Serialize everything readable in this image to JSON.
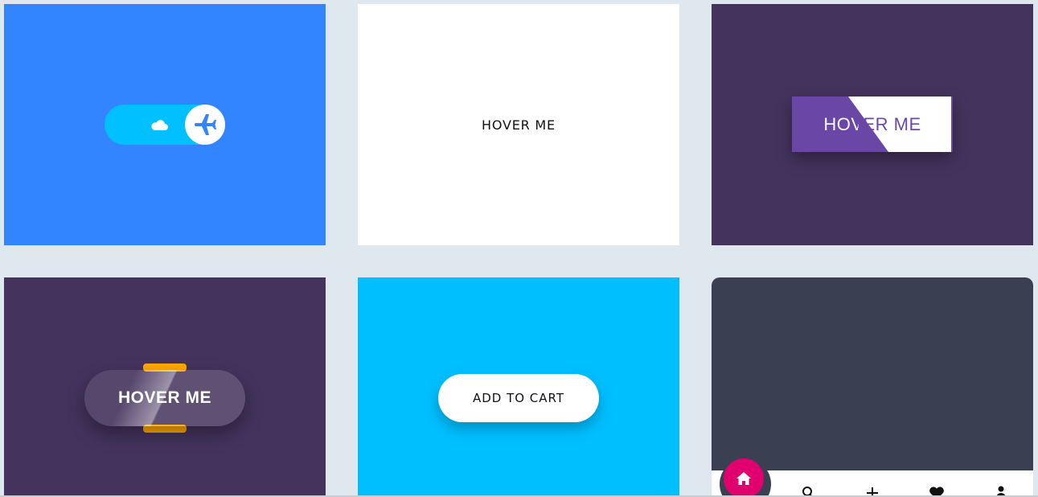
{
  "cards": {
    "toggle": {
      "icons": {
        "cloud": "cloud-icon",
        "knob": "airplane-icon"
      },
      "colors": {
        "background": "#3385ff",
        "track": "#00c0ff",
        "icon": "#3385ff"
      }
    },
    "plain": {
      "label": "HOVER ME"
    },
    "slant": {
      "label": "HOVER ME",
      "colors": {
        "background": "#44335d",
        "accent": "#6a47a6"
      }
    },
    "glass": {
      "label": "HOVER ME",
      "colors": {
        "background": "#44335d",
        "accent": "#ffa800"
      }
    },
    "cart": {
      "label": "ADD TO CART",
      "colors": {
        "background": "#00bfff"
      }
    },
    "navbar": {
      "active": "home-icon",
      "icons": [
        "home-icon",
        "search-icon",
        "plus-icon",
        "heart-icon",
        "user-icon"
      ],
      "colors": {
        "background": "#3a3f52",
        "active": "#e0006e"
      }
    }
  }
}
